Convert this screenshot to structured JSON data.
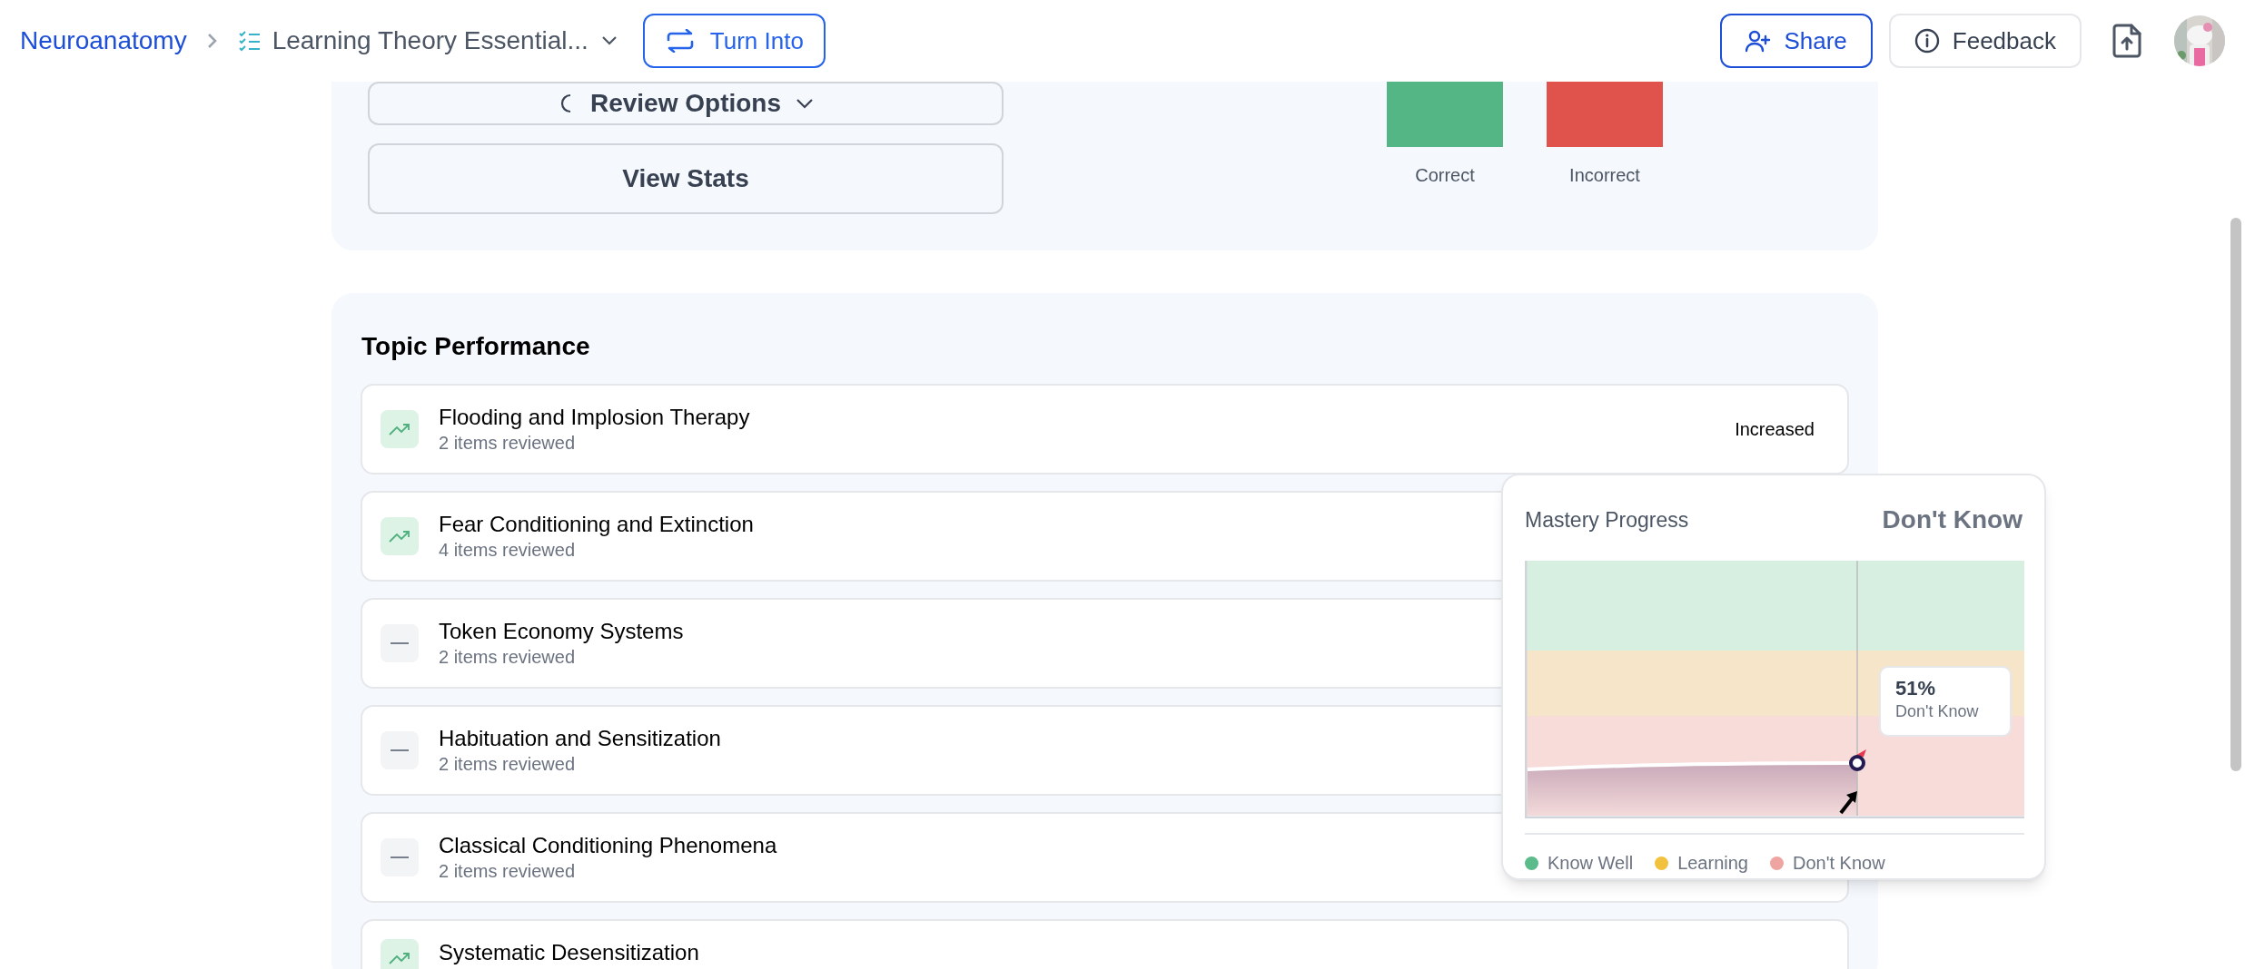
{
  "header": {
    "breadcrumb": "Neuroanatomy",
    "document": "Learning Theory Essential...",
    "turn_into": "Turn Into",
    "share": "Share",
    "feedback": "Feedback"
  },
  "review": {
    "options_button": "Review Options",
    "stats_button": "View Stats",
    "bars": [
      {
        "label": "Correct",
        "color": "#55b685"
      },
      {
        "label": "Incorrect",
        "color": "#e0534c"
      }
    ]
  },
  "topic_performance": {
    "title": "Topic Performance",
    "rows": [
      {
        "title": "Flooding and Implosion Therapy",
        "subtitle": "2 items reviewed",
        "kind": "increased",
        "status": "Increased"
      },
      {
        "title": "Fear Conditioning and Extinction",
        "subtitle": "4 items reviewed",
        "kind": "increased"
      },
      {
        "title": "Token Economy Systems",
        "subtitle": "2 items reviewed",
        "kind": "flat"
      },
      {
        "title": "Habituation and Sensitization",
        "subtitle": "2 items reviewed",
        "kind": "flat"
      },
      {
        "title": "Classical Conditioning Phenomena",
        "subtitle": "2 items reviewed",
        "kind": "flat"
      },
      {
        "title": "Systematic Desensitization",
        "kind": "increased"
      }
    ]
  },
  "mastery_popup": {
    "title": "Mastery Progress",
    "status": "Don't Know",
    "tooltip_value": "51%",
    "tooltip_label": "Don't Know",
    "legend": [
      {
        "label": "Know Well",
        "color": "#5cbb8a"
      },
      {
        "label": "Learning",
        "color": "#f2c23f"
      },
      {
        "label": "Don't Know",
        "color": "#eea4a0"
      }
    ]
  }
}
